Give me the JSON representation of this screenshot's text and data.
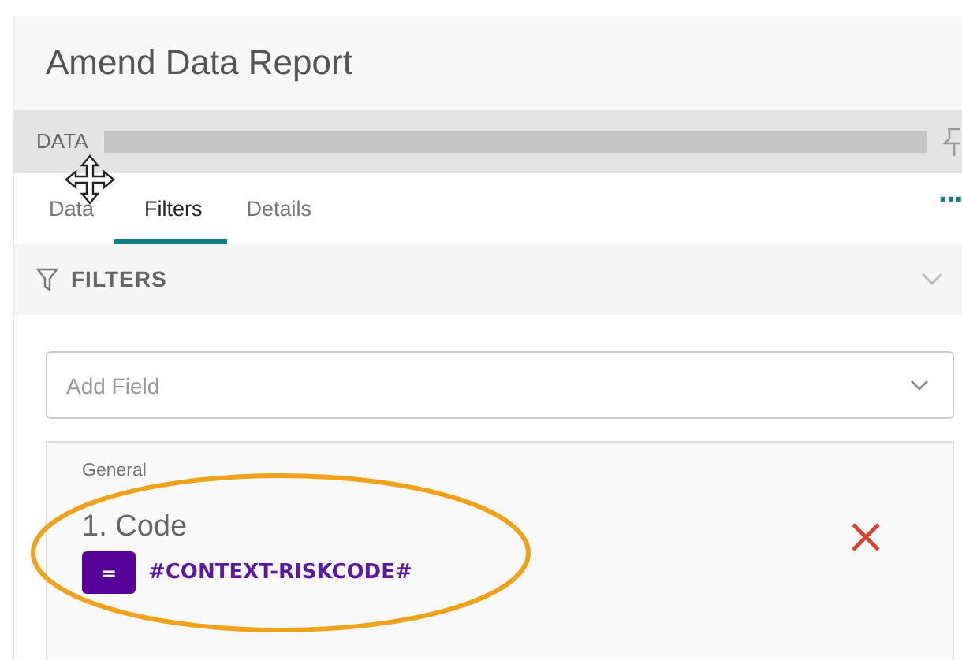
{
  "panel": {
    "title": "Amend Data Report",
    "data_bar": {
      "label": "DATA"
    }
  },
  "tabs": [
    {
      "label": "Data",
      "selected": false
    },
    {
      "label": "Filters",
      "selected": true
    },
    {
      "label": "Details",
      "selected": false
    }
  ],
  "more_menu": {
    "label": "···"
  },
  "filters_section": {
    "title": "FILTERS",
    "expanded": true
  },
  "add_field": {
    "placeholder": "Add Field"
  },
  "filter_items": [
    {
      "group": "General",
      "title": "1. Code",
      "operator": "=",
      "value": "#CONTEXT-RISKCODE#",
      "highlighted": true
    }
  ]
}
